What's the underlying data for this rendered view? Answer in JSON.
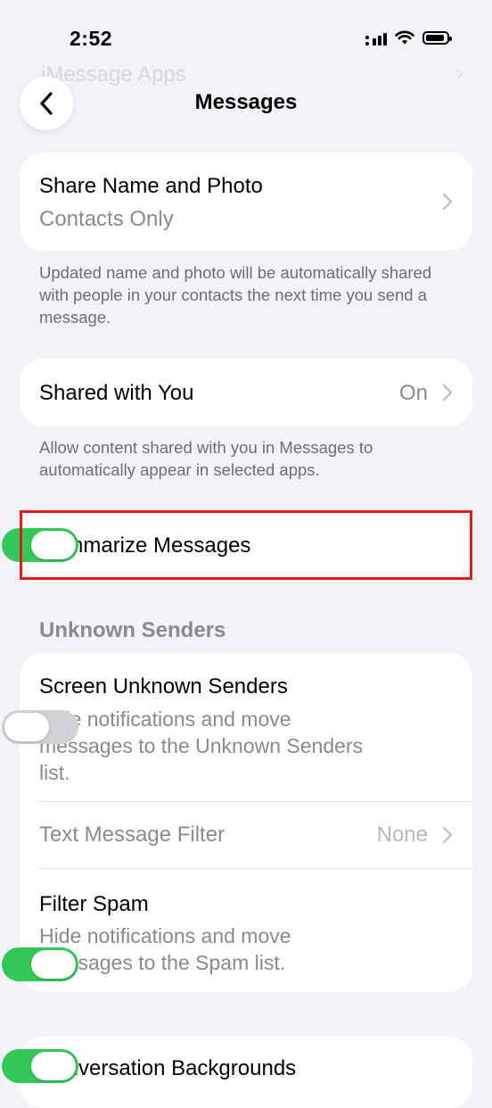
{
  "status_bar": {
    "time": "2:52"
  },
  "ghost": {
    "row_label": "iMessage Apps"
  },
  "nav": {
    "title": "Messages"
  },
  "share_name_photo": {
    "label": "Share Name and Photo",
    "value": "Contacts Only",
    "footer": "Updated name and photo will be automatically shared with people in your contacts the next time you send a message."
  },
  "shared_with_you": {
    "label": "Shared with You",
    "value": "On",
    "footer": "Allow content shared with you in Messages to automatically appear in selected apps."
  },
  "summarize": {
    "label": "Summarize Messages",
    "on": true
  },
  "unknown_senders": {
    "header": "Unknown Senders",
    "screen": {
      "label": "Screen Unknown Senders",
      "desc": "Hide notifications and move messages to the Unknown Senders list.",
      "on": false
    },
    "filter": {
      "label": "Text Message Filter",
      "value": "None"
    },
    "spam": {
      "label": "Filter Spam",
      "desc": "Hide notifications and move messages to the Spam list.",
      "on": true
    }
  },
  "conversation_backgrounds": {
    "label": "Conversation Backgrounds",
    "on": true
  },
  "colors": {
    "toggle_on": "#34c759",
    "toggle_off": "#d1d1d6",
    "highlight": "#e01b1b",
    "background": "#f2f2f7"
  }
}
